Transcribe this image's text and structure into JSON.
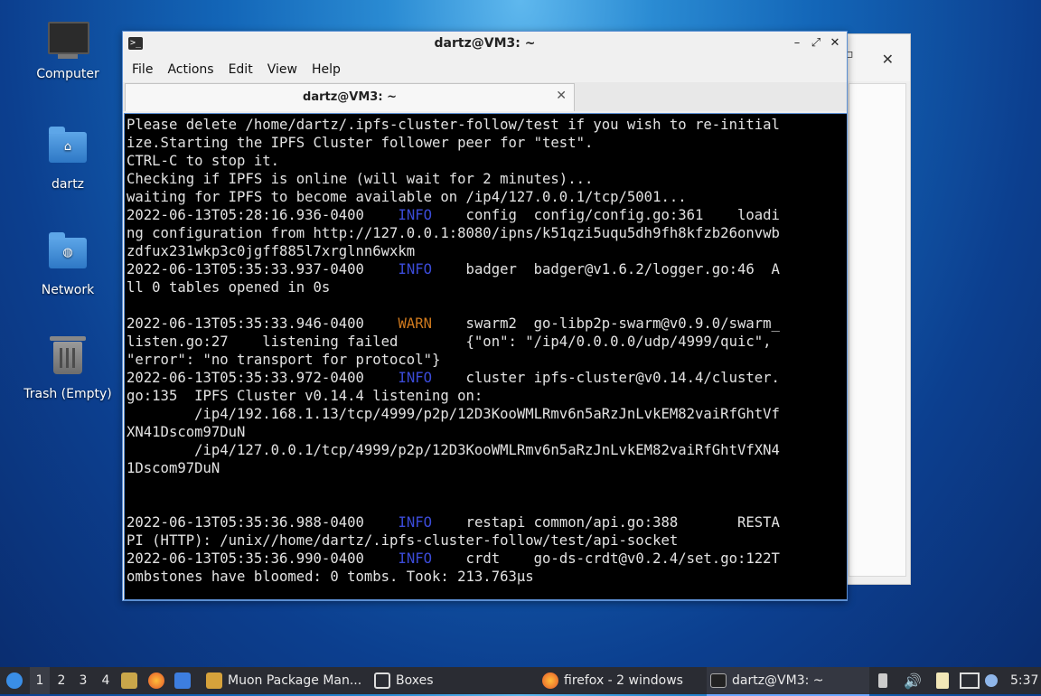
{
  "desktop": {
    "icons": [
      {
        "label": "Computer",
        "icon": "computer-icon"
      },
      {
        "label": "dartz",
        "icon": "home-folder-icon"
      },
      {
        "label": "Network",
        "icon": "network-folder-icon"
      },
      {
        "label": "Trash (Empty)",
        "icon": "trash-icon"
      }
    ]
  },
  "background_window": {
    "close_glyph": "✕",
    "side_glyph": "▫"
  },
  "terminal": {
    "title": "dartz@VM3: ~",
    "title_buttons": {
      "minimize": "–",
      "maximize": "⤢",
      "close": "✕"
    },
    "menu": [
      "File",
      "Actions",
      "Edit",
      "View",
      "Help"
    ],
    "tab": {
      "label": "dartz@VM3: ~",
      "close_glyph": "✕"
    },
    "lines": [
      [
        {
          "t": "Please delete /home/dartz/.ipfs-cluster-follow/test if you wish to re-initial"
        }
      ],
      [
        {
          "t": "ize.Starting the IPFS Cluster follower peer for \"test\"."
        }
      ],
      [
        {
          "t": "CTRL-C to stop it."
        }
      ],
      [
        {
          "t": "Checking if IPFS is online (will wait for 2 minutes)..."
        }
      ],
      [
        {
          "t": "waiting for IPFS to become available on /ip4/127.0.0.1/tcp/5001..."
        }
      ],
      [
        {
          "t": "2022-06-13T05:28:16.936-0400    "
        },
        {
          "t": "INFO",
          "c": "info"
        },
        {
          "t": "    config  config/config.go:361    loadi"
        }
      ],
      [
        {
          "t": "ng configuration from http://127.0.0.1:8080/ipns/k51qzi5uqu5dh9fh8kfzb26onvwb"
        }
      ],
      [
        {
          "t": "zdfux231wkp3c0jgff885l7xrglnn6wxkm"
        }
      ],
      [
        {
          "t": "2022-06-13T05:35:33.937-0400    "
        },
        {
          "t": "INFO",
          "c": "info"
        },
        {
          "t": "    badger  badger@v1.6.2/logger.go:46  A"
        }
      ],
      [
        {
          "t": "ll 0 tables opened in 0s"
        }
      ],
      [
        {
          "t": ""
        }
      ],
      [
        {
          "t": "2022-06-13T05:35:33.946-0400    "
        },
        {
          "t": "WARN",
          "c": "warn"
        },
        {
          "t": "    swarm2  go-libp2p-swarm@v0.9.0/swarm_"
        }
      ],
      [
        {
          "t": "listen.go:27    listening failed        {\"on\": \"/ip4/0.0.0.0/udp/4999/quic\","
        }
      ],
      [
        {
          "t": "\"error\": \"no transport for protocol\"}"
        }
      ],
      [
        {
          "t": "2022-06-13T05:35:33.972-0400    "
        },
        {
          "t": "INFO",
          "c": "info"
        },
        {
          "t": "    cluster ipfs-cluster@v0.14.4/cluster."
        }
      ],
      [
        {
          "t": "go:135  IPFS Cluster v0.14.4 listening on:"
        }
      ],
      [
        {
          "t": "        /ip4/192.168.1.13/tcp/4999/p2p/12D3KooWMLRmv6n5aRzJnLvkEM82vaiRfGhtVf"
        }
      ],
      [
        {
          "t": "XN41Dscom97DuN"
        }
      ],
      [
        {
          "t": "        /ip4/127.0.0.1/tcp/4999/p2p/12D3KooWMLRmv6n5aRzJnLvkEM82vaiRfGhtVfXN4"
        }
      ],
      [
        {
          "t": "1Dscom97DuN"
        }
      ],
      [
        {
          "t": ""
        }
      ],
      [
        {
          "t": ""
        }
      ],
      [
        {
          "t": "2022-06-13T05:35:36.988-0400    "
        },
        {
          "t": "INFO",
          "c": "info"
        },
        {
          "t": "    restapi common/api.go:388       RESTA"
        }
      ],
      [
        {
          "t": "PI (HTTP): /unix//home/dartz/.ipfs-cluster-follow/test/api-socket"
        }
      ],
      [
        {
          "t": "2022-06-13T05:35:36.990-0400    "
        },
        {
          "t": "INFO",
          "c": "info"
        },
        {
          "t": "    crdt    go-ds-crdt@v0.2.4/set.go:122T"
        }
      ],
      [
        {
          "t": "ombstones have bloomed: 0 tombs. Took: 213.763µs"
        }
      ]
    ]
  },
  "taskbar": {
    "workspaces": [
      "1",
      "2",
      "3",
      "4"
    ],
    "tasks": [
      {
        "label": "Muon Package Man...",
        "icon": "package-icon"
      },
      {
        "label": "Boxes",
        "icon": "boxes-icon"
      },
      {
        "label": "firefox - 2 windows",
        "icon": "firefox-icon"
      },
      {
        "label": "dartz@VM3: ~",
        "icon": "terminal-icon"
      }
    ],
    "clock": "5:37"
  },
  "colors": {
    "info": "#3b4bd8",
    "warn": "#d07a1e",
    "accent": "#5b8fd4"
  }
}
